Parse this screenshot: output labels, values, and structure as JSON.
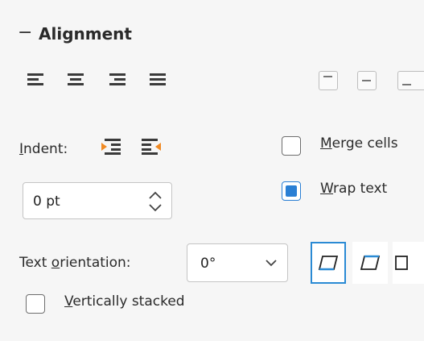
{
  "section": {
    "collapse_glyph": "−",
    "title": "Alignment"
  },
  "horizontal_alignment": [
    {
      "name": "align-left",
      "icon": "align-left-icon"
    },
    {
      "name": "align-center",
      "icon": "align-center-icon"
    },
    {
      "name": "align-right",
      "icon": "align-right-icon"
    },
    {
      "name": "align-justify",
      "icon": "align-justify-icon"
    }
  ],
  "vertical_alignment": [
    {
      "name": "align-top",
      "icon": "align-top-icon"
    },
    {
      "name": "align-middle",
      "icon": "align-middle-icon"
    },
    {
      "name": "align-bottom",
      "icon": "align-bottom-icon"
    }
  ],
  "indent": {
    "label_mnemonic": "I",
    "label_rest": "ndent:",
    "value": "0 pt"
  },
  "merge_cells": {
    "mnemonic": "M",
    "rest": "erge cells",
    "checked": false
  },
  "wrap_text": {
    "mnemonic": "W",
    "rest": "rap text",
    "checked": true
  },
  "text_orientation": {
    "label_pre": "Text ",
    "label_mnemonic": "o",
    "label_post": "rientation:",
    "value": "0°"
  },
  "vertically_stacked": {
    "mnemonic": "V",
    "rest": "ertically stacked",
    "checked": false
  },
  "colors": {
    "accent": "#2a8ad4",
    "icon_orange": "#f08a24",
    "icon_dark": "#3a3a3a"
  }
}
